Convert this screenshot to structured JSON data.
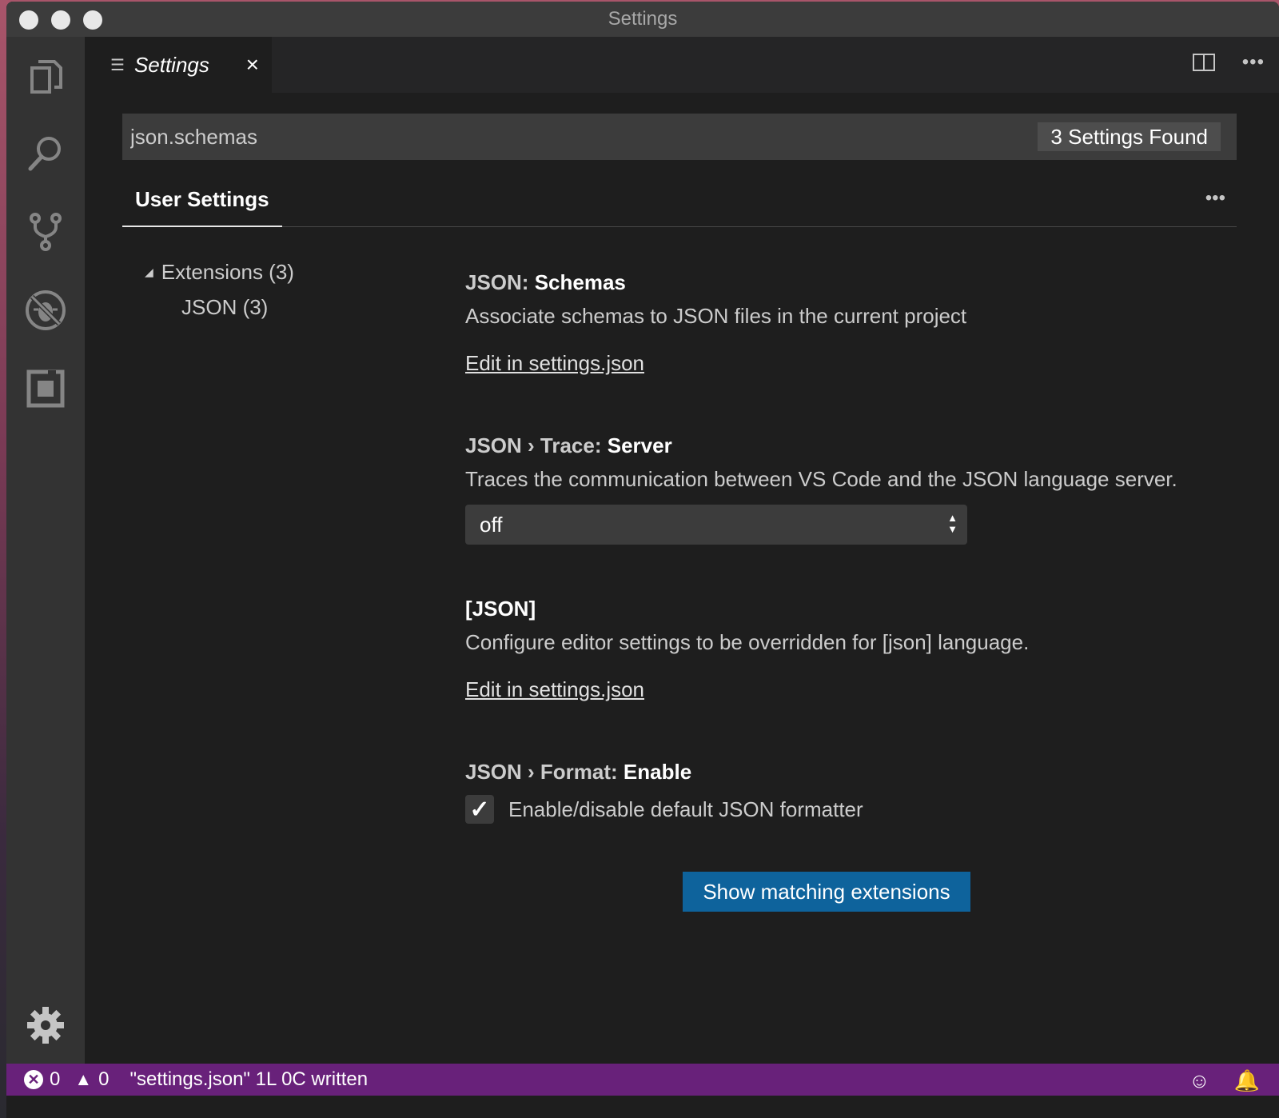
{
  "window": {
    "title": "Settings"
  },
  "activity_bar": {
    "items": [
      {
        "icon": "files-icon"
      },
      {
        "icon": "search-icon"
      },
      {
        "icon": "source-control-icon"
      },
      {
        "icon": "debug-icon"
      },
      {
        "icon": "extensions-icon"
      }
    ],
    "bottom_icon": "gear-icon"
  },
  "tab": {
    "label": "Settings",
    "close": "×"
  },
  "search": {
    "value": "json.schemas",
    "found_label": "3 Settings Found"
  },
  "settings_tabs": {
    "active": "User Settings"
  },
  "toc": {
    "group_label": "Extensions (3)",
    "child_label": "JSON (3)"
  },
  "settings": {
    "schemas": {
      "title_prefix": "JSON: ",
      "title_name": "Schemas",
      "description": "Associate schemas to JSON files in the current project",
      "link": "Edit in settings.json"
    },
    "trace": {
      "title_prefix": "JSON › Trace: ",
      "title_name": "Server",
      "description": "Traces the communication between VS Code and the JSON language server.",
      "value": "off"
    },
    "json_lang": {
      "title_name": "[JSON]",
      "description": "Configure editor settings to be overridden for [json] language.",
      "link": "Edit in settings.json"
    },
    "format": {
      "title_prefix": "JSON › Format: ",
      "title_name": "Enable",
      "checked": true,
      "label": "Enable/disable default JSON formatter"
    }
  },
  "button": {
    "label": "Show matching extensions"
  },
  "status_bar": {
    "errors": "0",
    "warnings": "0",
    "message": "\"settings.json\" 1L 0C written"
  },
  "colors": {
    "status_bar": "#68217a",
    "primary_button": "#0e639c",
    "editor_bg": "#1e1e1e",
    "activity_bar": "#333333"
  }
}
